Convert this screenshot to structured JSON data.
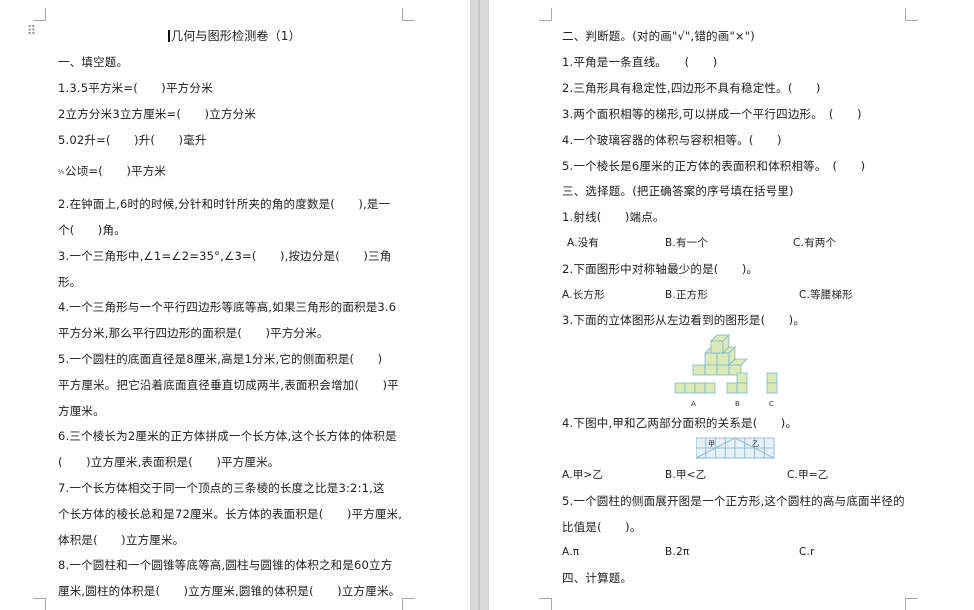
{
  "left_page": {
    "title": "几何与图形检测卷（1）",
    "section1": "一、填空题。",
    "q1a": "1.3.5平方米=(　　)平方分米",
    "q1b": "2立方分米3立方厘米=(　　)立方分米",
    "q1c": "5.02升=(　　)升(　　)毫升",
    "q1d": "公顷=(　　)平方米",
    "q2a": "2.在钟面上,6时的时候,分针和时针所夹的角的度数是(　　),是一",
    "q2b": "个(　　)角。",
    "q3a": "3.一个三角形中,∠1=∠2=35°,∠3=(　　),按边分是(　　)三角",
    "q3b": "形。",
    "q4a": "4.一个三角形与一个平行四边形等底等高,如果三角形的面积是3.6",
    "q4b": "平方分米,那么平行四边形的面积是(　　)平方分米。",
    "q5a": "5.一个圆柱的底面直径是8厘米,高是1分米,它的侧面积是(　　)",
    "q5b": "平方厘米。把它沿着底面直径垂直切成两半,表面积会增加(　　)平",
    "q5c": "方厘米。",
    "q6a": "6.三个棱长为2厘米的正方体拼成一个长方体,这个长方体的体积是",
    "q6b": "(　　)立方厘米,表面积是(　　)平方厘米。",
    "q7a": "7.一个长方体相交于同一个顶点的三条棱的长度之比是3:2:1,这",
    "q7b": "个长方体的棱长总和是72厘米。长方体的表面积是(　　)平方厘米,",
    "q7c": "体积是(　　)立方厘米。",
    "q8a": "8.一个圆柱和一个圆锥等底等高,圆柱与圆锥的体积之和是60立方",
    "q8b": "厘米,圆柱的体积是(　　)立方厘米,圆锥的体积是(　　)立方厘米。"
  },
  "right_page": {
    "section2": "二、判断题。(对的画\"√\",错的画\"×\")",
    "j1": "1.平角是一条直线。　　(　　)",
    "j2": "2.三角形具有稳定性,四边形不具有稳定性。(　　)",
    "j3": "3.两个面积相等的梯形,可以拼成一个平行四边形。　(　　)",
    "j4": "4.一个玻璃容器的体积与容积相等。(　　)",
    "j5": "5.一个棱长是6厘米的正方体的表面积和体积相等。　(　　)",
    "section3": "三、选择题。(把正确答案的序号填在括号里)",
    "c1": "1.射线(　　)端点。",
    "c1_a": "A.没有",
    "c1_b": "B.有一个",
    "c1_c": "C.有两个",
    "c2": "2.下面图形中对称轴最少的是(　　)。",
    "c2_a": "A.长方形",
    "c2_b": "B.正方形",
    "c2_c": "C.等腰梯形",
    "c3": "3.下面的立体图形从左边看到的图形是(　　)。",
    "fig3_labels": [
      "A",
      "B",
      "C"
    ],
    "c4": "4.下图中,甲和乙两部分面积的关系是(　　)。",
    "fig4_labels": [
      "甲",
      "乙"
    ],
    "c4_a": "A.甲>乙",
    "c4_b": "B.甲<乙",
    "c4_c": "C.甲=乙",
    "c5a": "5.一个圆柱的侧面展开图是一个正方形,这个圆柱的高与底面半径的",
    "c5b": "比值是(　　)。",
    "c5_a": "A.π",
    "c5_b": "B.2π",
    "c5_c": "C.r",
    "section4": "四、计算题。"
  },
  "colors": {
    "figure_fill": "#dcebb6",
    "figure_stroke": "#7db4d6",
    "workspace": "#e6e6e6"
  }
}
